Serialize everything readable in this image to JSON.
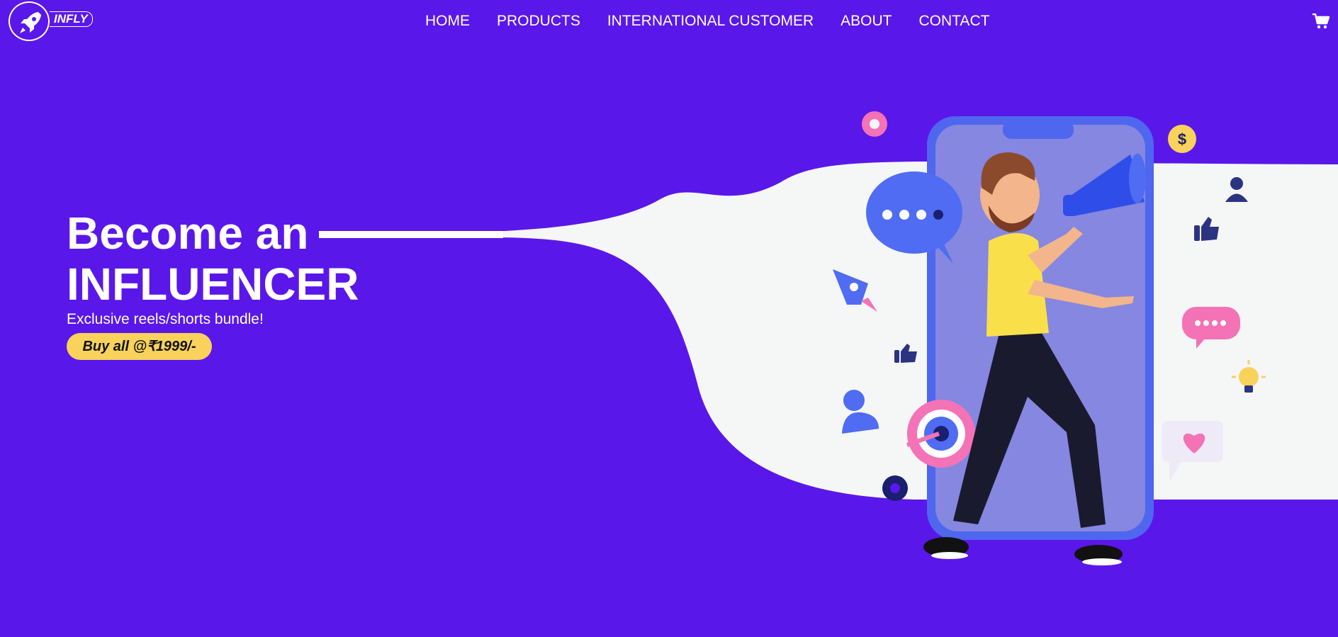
{
  "brand": {
    "name": "INFLY",
    "logo_icon": "rocket-icon"
  },
  "nav": {
    "items": [
      {
        "label": "HOME"
      },
      {
        "label": "PRODUCTS"
      },
      {
        "label": "INTERNATIONAL CUSTOMER"
      },
      {
        "label": "ABOUT"
      },
      {
        "label": "CONTACT"
      }
    ],
    "cart_icon": "cart-icon"
  },
  "hero": {
    "title_line1": "Become an",
    "title_line2": "INFLUENCER",
    "subtitle": "Exclusive reels/shorts bundle!",
    "cta_label": "Buy all @₹1999/-"
  },
  "colors": {
    "background": "#5a17ea",
    "cta": "#f8d25a",
    "text": "#ffffff",
    "wave": "#f5f6f6",
    "phone": "#4f6cf2"
  }
}
